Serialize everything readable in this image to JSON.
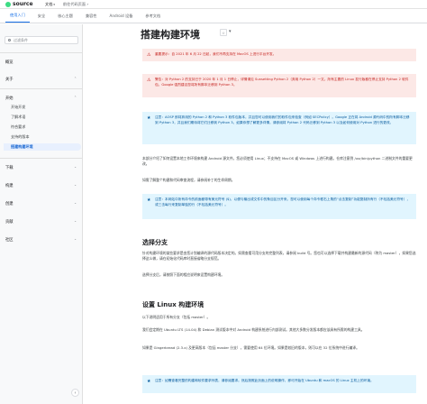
{
  "topbar": {
    "logo": "source",
    "items": [
      {
        "label": "文档",
        "caret": "▾"
      },
      {
        "label": "前往代码页面",
        "caret": "↗"
      }
    ]
  },
  "subtabs": [
    "使用入门",
    "安全",
    "核心主题",
    "兼容性",
    "Android 设备",
    "参考文档"
  ],
  "sidebar": {
    "search_placeholder": "过滤条件",
    "items": [
      {
        "label": "概览"
      },
      {
        "label": "关于",
        "chev": "⌃"
      },
      {
        "label": "开始",
        "chev": "⌃"
      },
      {
        "label": "下载",
        "chev": "⌄"
      },
      {
        "label": "构建",
        "chev": "⌄"
      },
      {
        "label": "创建",
        "chev": "⌄"
      },
      {
        "label": "贡献",
        "chev": "⌄"
      },
      {
        "label": "社区",
        "chev": "⌄"
      }
    ],
    "start_children": [
      "开始开发",
      "了解术语",
      "符合要求",
      "支持的版本"
    ],
    "active_item": "搭建构建环境",
    "collapse_glyph": "‹"
  },
  "main": {
    "title": "搭建构建环境",
    "bookmark_glyph": "☆",
    "more_glyph": "▾",
    "notes": [
      {
        "icon": "⚠",
        "text": "重要提示：自 2021 年 6 月 22 日起，我们不再支持在 MacOS 上进行平台开发。"
      },
      {
        "icon": "⚠",
        "text": "警告：对 Python 2 的支持已于 2020 年 1 月 1 日停止，详情请见 Sunsetting Python 2（弃用 Python 2）一文。所有主要的 Linux 发行版都在停止支持 Python 2 软件包。Google 强烈建议您将所有脚本迁移到 Python 3。"
      },
      {
        "icon": "★",
        "text": "注意：AOSP 即将弃用的 Python 2 和 Python 3 软件包版本，并且您可以使用我们的软件包来检查（例如 SECPolicy）。Google 正在将 Android 源代码中的所有脚本迁移到 Python 3，并且我们期待将它们迁移到 Python 3。如果你想了解更多详情，请参阅将 Python 2 代码迁移到 Python 3 以及如何使用对 Python 进行的更改。"
      },
      {
        "icon": "★",
        "text": "注意：本网站中所有命令的前面都带有美元符号 ($)，以便与输出或文件中的条目区分开来。您可以使用每个命令框右上角的“点击复制”功能复制所有行（不包括美元符号），或三击每行来复制单独的行（不包括美元符号）。"
      },
      {
        "icon": "★",
        "text": "注意：如需查看完整的构建和软件要求列表，请参阅要求。然后按照此页面上的说明操作，即可开始在 Ubuntu 和 macOS 的 Linux 主机上的环境。"
      }
    ],
    "intro": [
      "本部分介绍了如何设置本地工作环境来构建 Android 源文件。您必须使用 Linux；不支持在 MacOS 或 Windows 上进行构建。仓库注意到 /usr/bin/python 二进制文件的重要更改。",
      "如需了解整个构建和代码审查流程，请参阅补丁的生命周期。"
    ],
    "section1_title": "选择分支",
    "section1_paras": [
      "针对构建环境的某些要求是由您计划编译的源代码版本决定的。如需查看可用分支的完整列表，请参阅 build 号。您也可以选择下载并构建最新的源代码（称为 master），如果您选择这么做，请在初始化代码库时直接省略分支规范。",
      "选择分支后，请按照下面的相应说明来设置构建环境。"
    ],
    "section2_title": "设置 Linux 构建环境",
    "section2_paras": [
      "以下说明适用于所有分支（包括 master）。",
      "我们会定期在 Ubuntu LTS (14.04) 和 Debian 测试版本中对 Android 构建系统进行内部测试。其他大多数分发版本都应该具有所需的构建工具。",
      "如果是 Gingerbread (2.3.x) 及更高版本（包括 master 分支），需要使用 64 位环境。如果是较旧的版本，则可以在 32 位系统中进行编译。"
    ]
  },
  "colors": {
    "accent": "#1a73e8",
    "warn_bg": "#fce8e6",
    "note_bg": "#e1f5fe"
  }
}
